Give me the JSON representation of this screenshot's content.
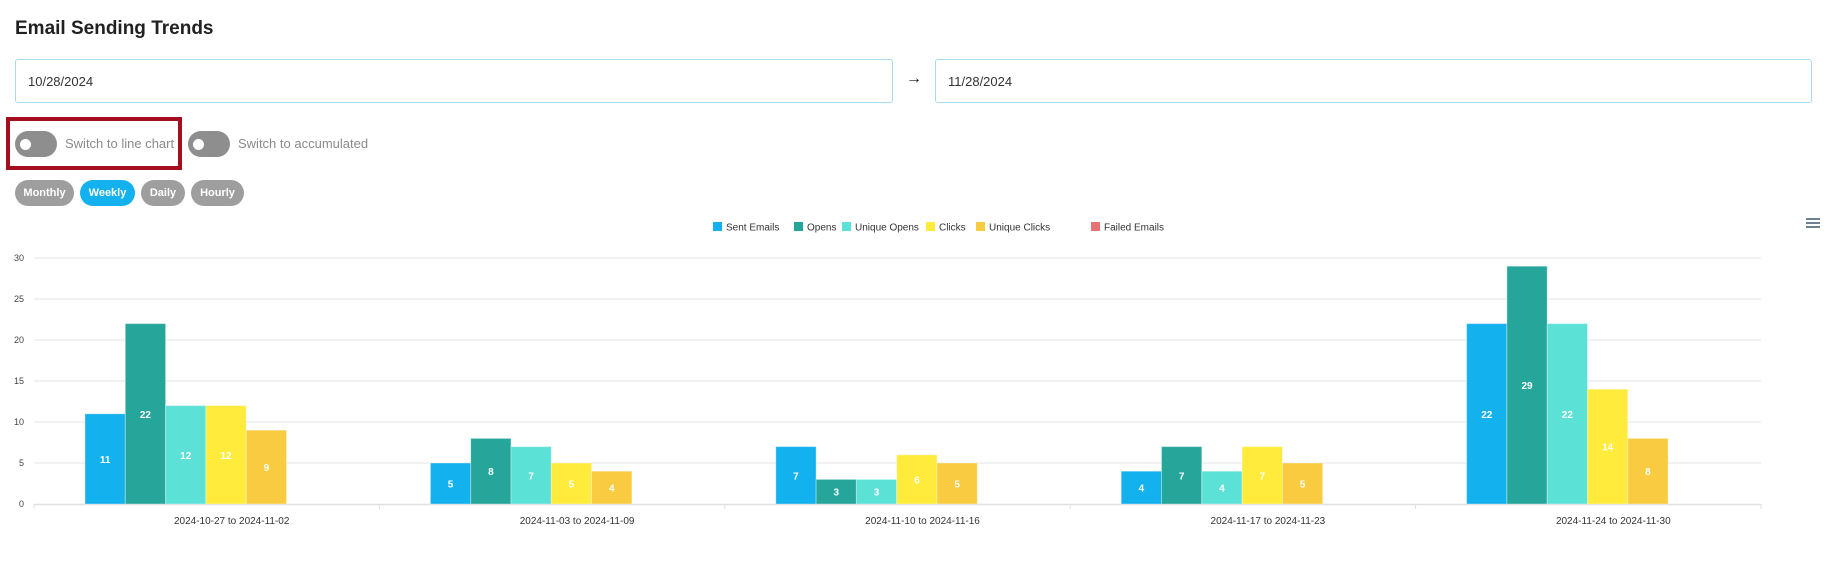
{
  "page": {
    "title": "Email Sending Trends"
  },
  "date_range": {
    "from": "10/28/2024",
    "to": "11/28/2024",
    "separator": "→"
  },
  "toggles": {
    "line_chart": {
      "label": "Switch to line chart",
      "on": false,
      "highlighted": true
    },
    "accumulated": {
      "label": "Switch to accumulated",
      "on": false
    }
  },
  "period_buttons": [
    {
      "label": "Monthly",
      "active": false
    },
    {
      "label": "Weekly",
      "active": true
    },
    {
      "label": "Daily",
      "active": false
    },
    {
      "label": "Hourly",
      "active": false
    }
  ],
  "chart_menu": {
    "icon": "hamburger-menu-icon"
  },
  "chart_data": {
    "type": "bar",
    "title": "",
    "xlabel": "",
    "ylabel": "",
    "ylim": [
      0,
      30
    ],
    "yticks": [
      0,
      5,
      10,
      15,
      20,
      25,
      30
    ],
    "grid": true,
    "legend_position": "top-center",
    "data_labels": true,
    "categories": [
      "2024-10-27 to 2024-11-02",
      "2024-11-03 to 2024-11-09",
      "2024-11-10 to 2024-11-16",
      "2024-11-17 to 2024-11-23",
      "2024-11-24 to 2024-11-30"
    ],
    "series": [
      {
        "name": "Sent Emails",
        "color": "#13B1EE",
        "values": [
          11,
          5,
          7,
          4,
          22
        ]
      },
      {
        "name": "Opens",
        "color": "#26A69A",
        "values": [
          22,
          8,
          3,
          7,
          29
        ]
      },
      {
        "name": "Unique Opens",
        "color": "#5CE1D7",
        "values": [
          12,
          7,
          3,
          4,
          22
        ]
      },
      {
        "name": "Clicks",
        "color": "#FFEB3B",
        "values": [
          12,
          5,
          6,
          7,
          14
        ]
      },
      {
        "name": "Unique Clicks",
        "color": "#F9CB40",
        "values": [
          9,
          4,
          5,
          5,
          8
        ]
      },
      {
        "name": "Failed Emails",
        "color": "#E57373",
        "values": [
          0,
          0,
          0,
          0,
          0
        ]
      }
    ]
  }
}
